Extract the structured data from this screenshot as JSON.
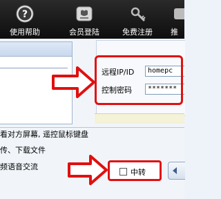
{
  "toolbar": {
    "items": [
      {
        "label": "使用帮助",
        "icon": "help-icon"
      },
      {
        "label": "会员登陆",
        "icon": "member-login-icon"
      },
      {
        "label": "免费注册",
        "icon": "register-icon"
      },
      {
        "label": "推",
        "icon": "recommend-icon"
      }
    ]
  },
  "connect": {
    "remote_label": "远程IP/ID",
    "remote_value": "homepc",
    "password_label": "控制密码",
    "password_value": "*******"
  },
  "features": [
    "看对方屏幕, 遥控鼠标键盘",
    "传、下载文件",
    "频语音交流"
  ],
  "relay": {
    "label": "中转",
    "checked": false
  },
  "colors": {
    "highlight": "#e01010",
    "toolbar": "#1a1a1a"
  }
}
